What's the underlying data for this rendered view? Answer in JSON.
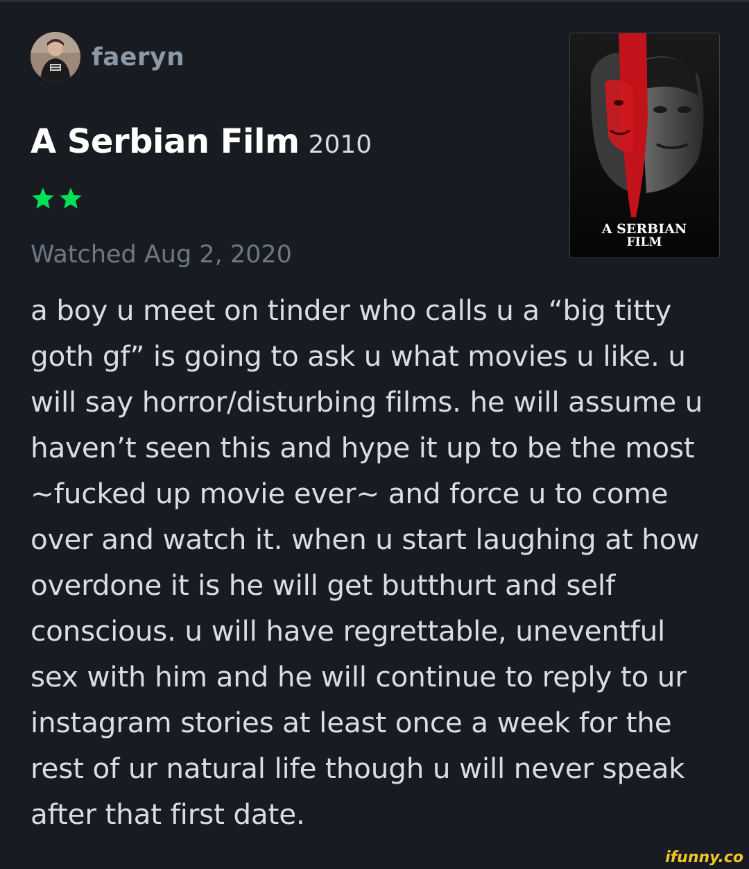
{
  "user": {
    "name": "faeryn",
    "avatar_icon": "user-avatar"
  },
  "film": {
    "title": "A Serbian Film",
    "year": "2010",
    "poster_line1": "A SERBIAN",
    "poster_line2": "FILM"
  },
  "rating": {
    "stars": 2,
    "star_color": "#00e054"
  },
  "watched_text": "Watched Aug 2, 2020",
  "review": {
    "lines": [
      "a boy u meet on tinder who calls u a “big titty",
      "goth gf” is going to ask u what movies u like. u",
      "will say horror/disturbing films. he will assume u",
      "haven’t seen this and hype it up to be the most",
      "~fucked up movie ever~ and force u to come",
      "over and watch it. when u start laughing at how",
      "overdone it is he will get butthurt and self",
      "conscious. u will have regrettable, uneventful",
      "sex with him and he will continue to reply to ur",
      "instagram stories at least once a week for the",
      "rest of ur natural life though u will never speak",
      "after that first date."
    ]
  },
  "watermark": "ifunny.co",
  "colors": {
    "background": "#181c22",
    "text": "#d7dee6",
    "muted": "#6c7886",
    "username": "#8b98a7",
    "watermark": "#f3c52a"
  }
}
